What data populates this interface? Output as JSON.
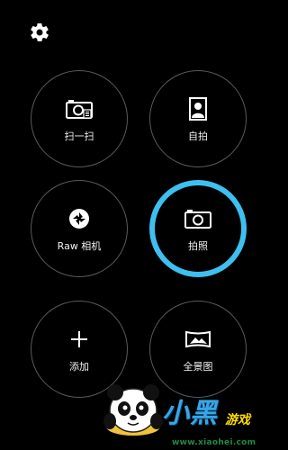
{
  "settings": {
    "icon": "gear-icon"
  },
  "modes": [
    {
      "id": "scan",
      "label": "扫一扫",
      "icon": "camera-scan-icon",
      "selected": false
    },
    {
      "id": "selfie",
      "label": "自拍",
      "icon": "selfie-portrait-icon",
      "selected": false
    },
    {
      "id": "raw",
      "label": "Raw 相机",
      "icon": "aperture-icon",
      "selected": false
    },
    {
      "id": "photo",
      "label": "拍照",
      "icon": "camera-icon",
      "selected": true
    },
    {
      "id": "add",
      "label": "添加",
      "icon": "plus-icon",
      "selected": false
    },
    {
      "id": "panorama",
      "label": "全景图",
      "icon": "panorama-icon",
      "selected": false
    }
  ],
  "watermark": {
    "text_main": "小黑",
    "text_sub": "游戏",
    "url": "www.xiaohei.com"
  },
  "colors": {
    "background": "#000000",
    "ring": "#5a5a5a",
    "selected_ring": "#3dc0f0",
    "text": "#f2f2f2"
  }
}
